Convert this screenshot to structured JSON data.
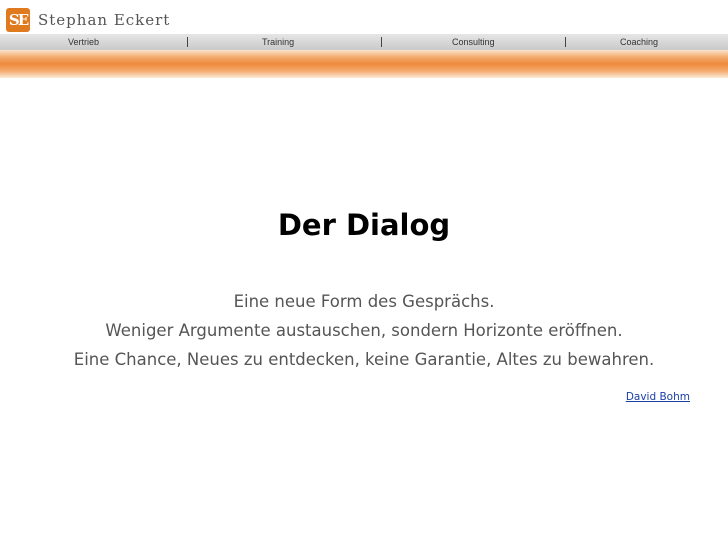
{
  "header": {
    "logo_mark": "SE",
    "logo_text": "Stephan Eckert",
    "brand_color": "#e07a1f"
  },
  "nav": {
    "items": [
      {
        "label": "Vertrieb"
      },
      {
        "label": "Training"
      },
      {
        "label": "Consulting"
      },
      {
        "label": "Coaching"
      }
    ]
  },
  "slide": {
    "title": "Der Dialog",
    "lines": [
      "Eine neue Form des Gesprächs.",
      "Weniger Argumente austauschen, sondern Horizonte eröffnen.",
      "Eine Chance, Neues zu entdecken, keine Garantie, Altes zu bewahren."
    ],
    "author": "David Bohm",
    "link_color": "#1a3fa6"
  }
}
